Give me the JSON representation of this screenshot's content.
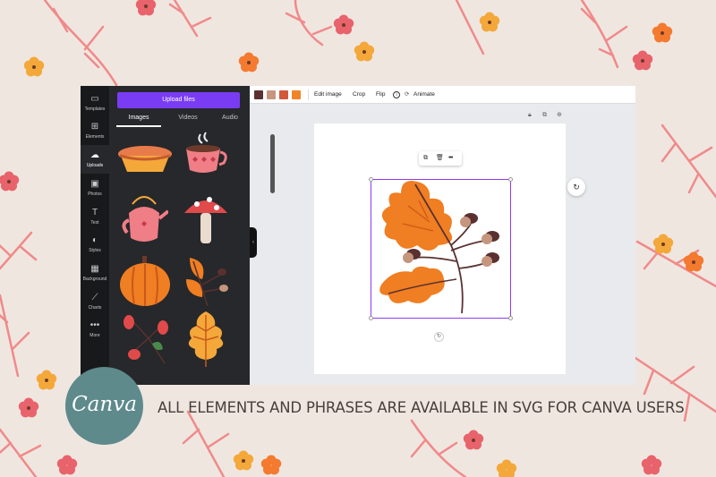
{
  "sidebar": {
    "items": [
      {
        "label": "Templates",
        "icon": "templates-icon"
      },
      {
        "label": "Elements",
        "icon": "elements-icon"
      },
      {
        "label": "Uploads",
        "icon": "upload-cloud-icon"
      },
      {
        "label": "Photos",
        "icon": "photos-icon"
      },
      {
        "label": "Text",
        "icon": "text-icon"
      },
      {
        "label": "Styles",
        "icon": "styles-palette-icon"
      },
      {
        "label": "Background",
        "icon": "background-pattern-icon"
      },
      {
        "label": "Charts",
        "icon": "charts-icon"
      },
      {
        "label": "More",
        "icon": "more-dots-icon"
      }
    ],
    "active": "Uploads"
  },
  "panel": {
    "upload_button": "Upload files",
    "tabs": [
      {
        "label": "Images"
      },
      {
        "label": "Videos"
      },
      {
        "label": "Audio"
      }
    ],
    "active_tab": "Images",
    "thumbnails": [
      "pie",
      "teacup",
      "teapot",
      "mushroom",
      "pumpkin",
      "leaves-acorns",
      "rosehip-berries",
      "oak-leaf"
    ]
  },
  "toolbar": {
    "colors": [
      "#5a3130",
      "#c6957e",
      "#d2583a",
      "#f08426"
    ],
    "edit_image": "Edit image",
    "crop": "Crop",
    "flip": "Flip",
    "info_icon": "info-icon",
    "animate": "Animate"
  },
  "element_toolbar": {
    "icons": [
      "duplicate-icon",
      "trash-icon",
      "more-icon"
    ]
  },
  "page_controls": {
    "icons": [
      "lock-icon",
      "copy-page-icon",
      "add-page-icon"
    ]
  },
  "branding": {
    "logo_text": "Canva",
    "logo_color": "#5e8a8c",
    "banner": "ALL ELEMENTS AND PHRASES ARE AVAILABLE IN SVG FOR CANVA USERS"
  },
  "colors": {
    "accent": "#7a3cf2",
    "selection": "#8b3cf6",
    "sidebar_bg": "#18191b",
    "panel_bg": "#26282b",
    "background": "#efe6e0"
  }
}
